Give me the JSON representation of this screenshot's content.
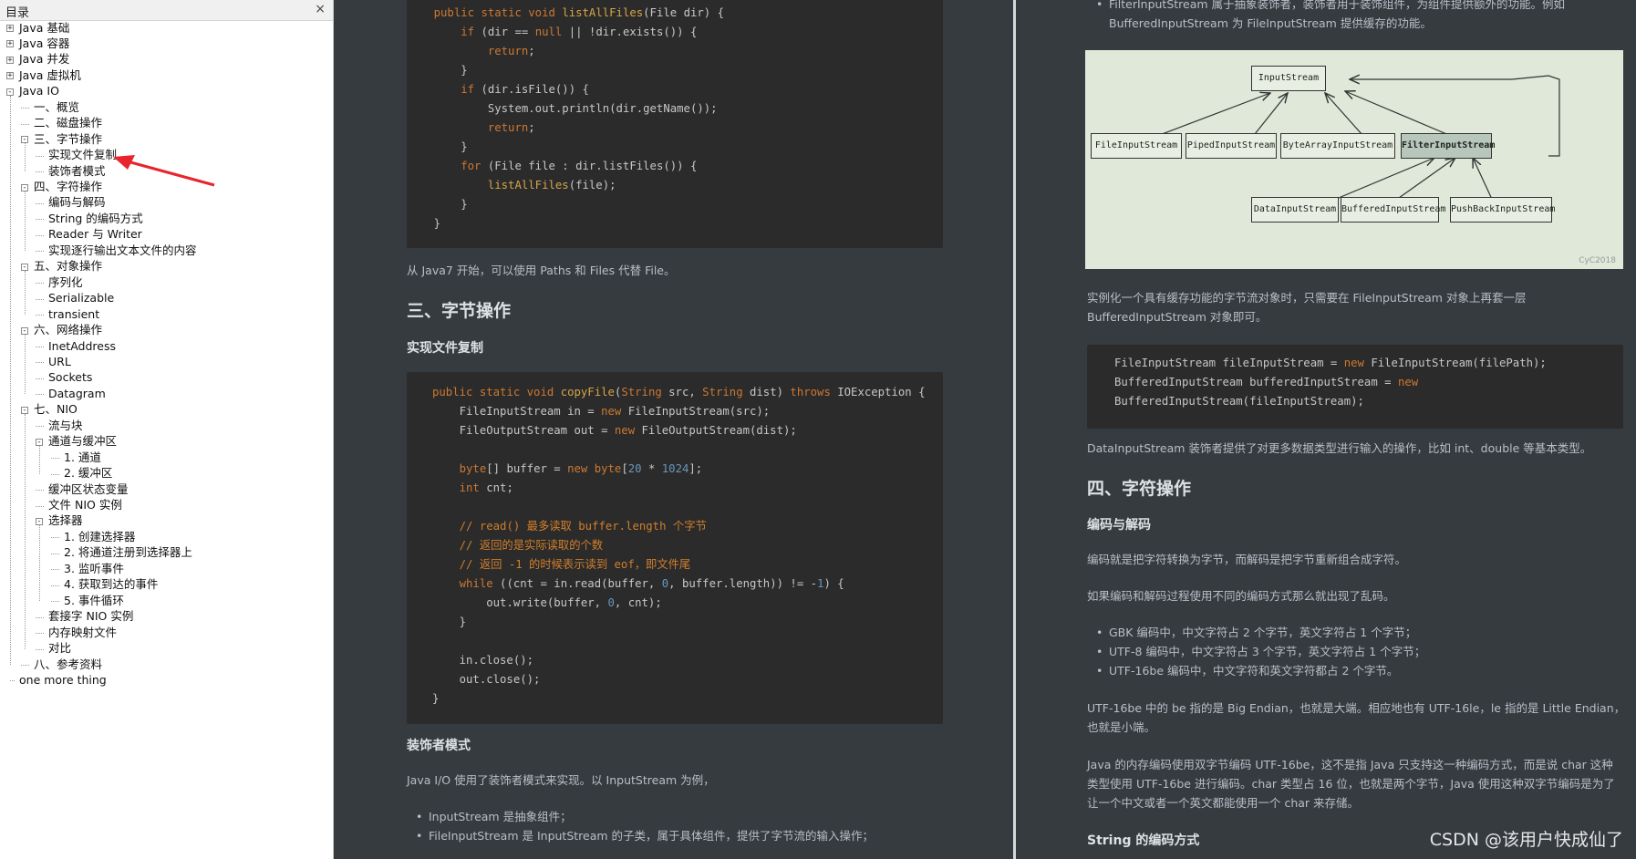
{
  "toc": {
    "title": "目录",
    "close": "×",
    "items": [
      {
        "label": "Java 基础",
        "level": 0,
        "toggle": "+"
      },
      {
        "label": "Java 容器",
        "level": 0,
        "toggle": "+"
      },
      {
        "label": "Java 并发",
        "level": 0,
        "toggle": "+"
      },
      {
        "label": "Java 虚拟机",
        "level": 0,
        "toggle": "+"
      },
      {
        "label": "Java IO",
        "level": 0,
        "toggle": "-"
      },
      {
        "label": "一、概览",
        "level": 1,
        "toggle": ""
      },
      {
        "label": "二、磁盘操作",
        "level": 1,
        "toggle": ""
      },
      {
        "label": "三、字节操作",
        "level": 1,
        "toggle": "-"
      },
      {
        "label": "实现文件复制",
        "level": 2,
        "toggle": ""
      },
      {
        "label": "装饰者模式",
        "level": 2,
        "toggle": ""
      },
      {
        "label": "四、字符操作",
        "level": 1,
        "toggle": "-"
      },
      {
        "label": "编码与解码",
        "level": 2,
        "toggle": ""
      },
      {
        "label": "String 的编码方式",
        "level": 2,
        "toggle": ""
      },
      {
        "label": "Reader 与 Writer",
        "level": 2,
        "toggle": ""
      },
      {
        "label": "实现逐行输出文本文件的内容",
        "level": 2,
        "toggle": ""
      },
      {
        "label": "五、对象操作",
        "level": 1,
        "toggle": "-"
      },
      {
        "label": "序列化",
        "level": 2,
        "toggle": ""
      },
      {
        "label": "Serializable",
        "level": 2,
        "toggle": ""
      },
      {
        "label": "transient",
        "level": 2,
        "toggle": ""
      },
      {
        "label": "六、网络操作",
        "level": 1,
        "toggle": "-"
      },
      {
        "label": "InetAddress",
        "level": 2,
        "toggle": ""
      },
      {
        "label": "URL",
        "level": 2,
        "toggle": ""
      },
      {
        "label": "Sockets",
        "level": 2,
        "toggle": ""
      },
      {
        "label": "Datagram",
        "level": 2,
        "toggle": ""
      },
      {
        "label": "七、NIO",
        "level": 1,
        "toggle": "-"
      },
      {
        "label": "流与块",
        "level": 2,
        "toggle": ""
      },
      {
        "label": "通道与缓冲区",
        "level": 2,
        "toggle": "-"
      },
      {
        "label": "1. 通道",
        "level": 3,
        "toggle": ""
      },
      {
        "label": "2. 缓冲区",
        "level": 3,
        "toggle": ""
      },
      {
        "label": "缓冲区状态变量",
        "level": 2,
        "toggle": ""
      },
      {
        "label": "文件 NIO 实例",
        "level": 2,
        "toggle": ""
      },
      {
        "label": "选择器",
        "level": 2,
        "toggle": "-"
      },
      {
        "label": "1. 创建选择器",
        "level": 3,
        "toggle": ""
      },
      {
        "label": "2. 将通道注册到选择器上",
        "level": 3,
        "toggle": ""
      },
      {
        "label": "3. 监听事件",
        "level": 3,
        "toggle": ""
      },
      {
        "label": "4. 获取到达的事件",
        "level": 3,
        "toggle": ""
      },
      {
        "label": "5. 事件循环",
        "level": 3,
        "toggle": ""
      },
      {
        "label": "套接字 NIO 实例",
        "level": 2,
        "toggle": ""
      },
      {
        "label": "内存映射文件",
        "level": 2,
        "toggle": ""
      },
      {
        "label": "对比",
        "level": 2,
        "toggle": ""
      },
      {
        "label": "八、参考资料",
        "level": 1,
        "toggle": ""
      },
      {
        "label": "one more thing",
        "level": 0,
        "toggle": ""
      }
    ]
  },
  "pane1": {
    "code1": [
      "    public static void listAllFiles(File dir) {",
      "        if (dir == null || !dir.exists()) {",
      "            return;",
      "        }",
      "        if (dir.isFile()) {",
      "            System.out.println(dir.getName());",
      "            return;",
      "        }",
      "        for (File file : dir.listFiles()) {",
      "            listAllFiles(file);",
      "        }",
      "    }"
    ],
    "para_java7": "从 Java7 开始，可以使用 Paths 和 Files 代替 File。",
    "h2_bytes": "三、字节操作",
    "h3_copy": "实现文件复制",
    "code2": [
      "public static void copyFile(String src, String dist) throws IOException {",
      "    FileInputStream in = new FileInputStream(src);",
      "    FileOutputStream out = new FileOutputStream(dist);",
      "",
      "    byte[] buffer = new byte[20 * 1024];",
      "    int cnt;",
      "",
      "    // read() 最多读取 buffer.length 个字节",
      "    // 返回的是实际读取的个数",
      "    // 返回 -1 的时候表示读到 eof，即文件尾",
      "    while ((cnt = in.read(buffer, 0, buffer.length)) != -1) {",
      "        out.write(buffer, 0, cnt);",
      "    }",
      "",
      "    in.close();",
      "    out.close();",
      "}"
    ],
    "h3_decorator": "装饰者模式",
    "para_decorator": "Java I/O 使用了装饰者模式来实现。以 InputStream 为例，",
    "bullets": [
      "InputStream 是抽象组件；",
      "FileInputStream 是 InputStream 的子类，属于具体组件，提供了字节流的输入操作；"
    ]
  },
  "pane2": {
    "top_bullet_line1": "FilterInputStream 属于抽象装饰者，装饰者用于装饰组件，为组件提供额外的功能。例如",
    "top_bullet_line2": "BufferedInputStream 为 FileInputStream 提供缓存的功能。",
    "diagram": {
      "nodes": {
        "input_stream": "InputStream",
        "file": "FileInputStream",
        "piped": "PipedInputStream",
        "byte_array": "ByteArrayInputStream",
        "filter": "FilterInputStream",
        "data": "DataInputStream",
        "buffered": "BufferedInputStream",
        "pushback": "PushBackInputStream"
      },
      "watermark": "CyC2018"
    },
    "para_instance_1": "实例化一个具有缓存功能的字节流对象时，只需要在 FileInputStream 对象上再套一层",
    "para_instance_2": "BufferedInputStream 对象即可。",
    "code3": [
      "FileInputStream fileInputStream = new FileInputStream(filePath);",
      "BufferedInputStream bufferedInputStream = new",
      "BufferedInputStream(fileInputStream);"
    ],
    "para_data": "DataInputStream 装饰者提供了对更多数据类型进行输入的操作，比如 int、double 等基本类型。",
    "h2_chars": "四、字符操作",
    "h3_encode": "编码与解码",
    "para_encode": "编码就是把字符转换为字节，而解码是把字节重新组合成字符。",
    "para_garbled": "如果编码和解码过程使用不同的编码方式那么就出现了乱码。",
    "bullets": [
      "GBK 编码中，中文字符占 2 个字节，英文字符占 1 个字节；",
      "UTF-8 编码中，中文字符占 3 个字节，英文字符占 1 个字节；",
      "UTF-16be 编码中，中文字符和英文字符都占 2 个字节。"
    ],
    "para_utf16_1": "UTF-16be 中的 be 指的是 Big Endian，也就是大端。相应地也有 UTF-16le，le 指的是 Little Endian，",
    "para_utf16_2": "也就是小端。",
    "para_mem_1": "Java 的内存编码使用双字节编码 UTF-16be，这不是指 Java 只支持这一种编码方式，而是说 char 这种",
    "para_mem_2": "类型使用 UTF-16be 进行编码。char 类型占 16 位，也就是两个字节，Java 使用这种双字节编码是为了",
    "para_mem_3": "让一个中文或者一个英文都能使用一个 char 来存储。",
    "h3_string": "String 的编码方式"
  },
  "watermark": "CSDN @该用户快成仙了",
  "colors": {
    "bg": "#363B40",
    "code_bg": "#2b2b2b",
    "keyword": "#cc7832",
    "number": "#6897bb",
    "comment": "#d07f2c",
    "arrow": "#e8242c"
  }
}
